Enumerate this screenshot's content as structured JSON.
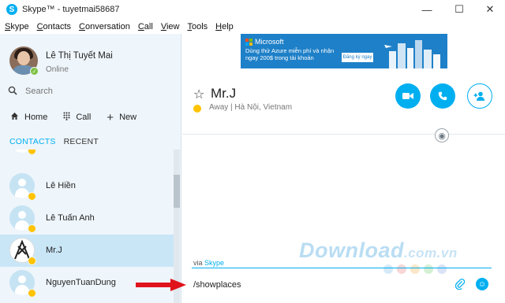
{
  "window": {
    "title": "Skype™ - tuyetmai58687",
    "app_icon": "skype-logo-icon",
    "controls": [
      "minimize-icon",
      "maximize-icon",
      "close-icon"
    ]
  },
  "menu": [
    "Skype",
    "Contacts",
    "Conversation",
    "Call",
    "View",
    "Tools",
    "Help"
  ],
  "profile": {
    "name": "Lê Thị Tuyết Mai",
    "status": "Online"
  },
  "search": {
    "placeholder": "Search"
  },
  "nav": {
    "home": "Home",
    "call": "Call",
    "new": "New"
  },
  "tabs": {
    "contacts": "CONTACTS",
    "recent": "RECENT"
  },
  "contacts": [
    {
      "name": "Lê Hiền",
      "status": "away"
    },
    {
      "name": "Lê Tuấn Anh",
      "status": "away"
    },
    {
      "name": "Mr.J",
      "status": "away",
      "selected": true
    },
    {
      "name": "NguyenTuanDung",
      "status": "away"
    }
  ],
  "ad": {
    "brand": "Microsoft",
    "text": "Dùng thử Azure miễn phí và nhận ngay 200$ trong tài khoản",
    "button": "Đăng ký ngay"
  },
  "conversation": {
    "contact_name": "Mr.J",
    "status": "Away",
    "location": "Hà Nội, Vietnam",
    "status_line": "Away | Hà Nội, Vietnam"
  },
  "compose": {
    "via_label": "via",
    "via_service": "Skype",
    "text": "/showplaces"
  },
  "watermark": {
    "text": "Download",
    "domain": ".com.vn"
  },
  "colors": {
    "accent": "#00aff0",
    "away": "#ffc300",
    "online": "#7dc242",
    "selected_row": "#c9e6f7",
    "arrow": "#e0141b"
  }
}
